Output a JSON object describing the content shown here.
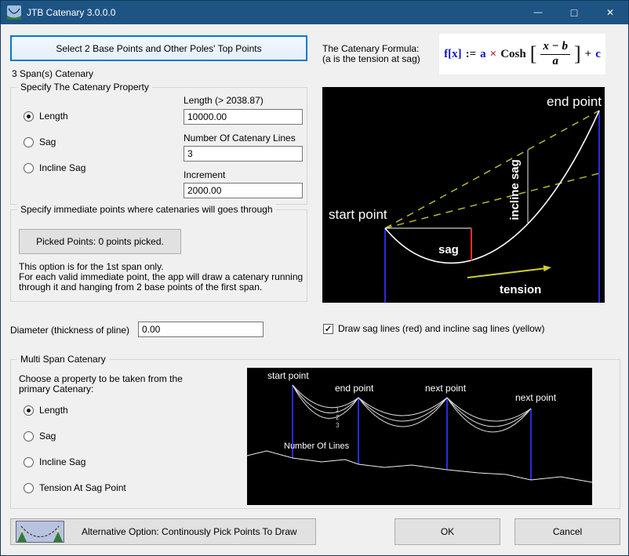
{
  "window": {
    "title": "JTB Catenary 3.0.0.0",
    "buttons": {
      "minimize": "—",
      "maximize": "□",
      "close": "✕"
    }
  },
  "top": {
    "select_button": "Select 2 Base Points and Other Poles' Top Points",
    "span_label": "3 Span(s) Catenary",
    "formula_caption_line1": "The Catenary Formula:",
    "formula_caption_line2": "(a is the tension at sag)",
    "formula": {
      "lhs": "f[x]",
      "assign": ":=",
      "a": "a",
      "times": "×",
      "func": "Cosh",
      "bracket_open": "[",
      "numerator": "x − b",
      "denominator": "a",
      "bracket_close": "]",
      "plus": "+",
      "c": "c"
    }
  },
  "property_group": {
    "title": "Specify The Catenary Property",
    "radios": [
      {
        "label": "Length",
        "selected": true
      },
      {
        "label": "Sag",
        "selected": false
      },
      {
        "label": "Incline Sag",
        "selected": false
      }
    ],
    "fields": [
      {
        "label": "Length (> 2038.87)",
        "value": "10000.00"
      },
      {
        "label": "Number Of Catenary Lines",
        "value": "3"
      },
      {
        "label": "Increment",
        "value": "2000.00"
      }
    ]
  },
  "immediate_group": {
    "title": "Specify immediate points where catenaries will goes through",
    "picked_button": "Picked Points: 0 points picked.",
    "notes": [
      "This option is for the 1st span only.",
      "For each valid immediate point, the app will draw a catenary running",
      "through it and  hanging from 2 base points of the first span."
    ]
  },
  "diameter": {
    "label": "Diameter (thickness of pline)",
    "value": "0.00"
  },
  "sag_checkbox": {
    "label": "Draw sag lines (red) and incline sag lines (yellow)",
    "checked": true,
    "check_glyph": "✓"
  },
  "diagram1": {
    "end_point": "end point",
    "start_point": "start point",
    "sag": "sag",
    "incline_sag": "incline sag",
    "tension": "tension"
  },
  "multi_group": {
    "title": "Multi Span Catenary",
    "caption_line1": "Choose a property to be taken from the",
    "caption_line2": "primary Catenary:",
    "radios": [
      {
        "label": "Length",
        "selected": true
      },
      {
        "label": "Sag",
        "selected": false
      },
      {
        "label": "Incline Sag",
        "selected": false
      },
      {
        "label": "Tension At Sag Point",
        "selected": false
      }
    ],
    "diagram": {
      "start_point": "start point",
      "end_point": "end point",
      "next_point1": "next point",
      "next_point2": "next point",
      "lines_label": "Number Of Lines",
      "numbers": [
        "1",
        "2",
        "3"
      ]
    }
  },
  "footer": {
    "alt_button": "Alternative Option: Continously Pick Points To Draw",
    "ok": "OK",
    "cancel": "Cancel"
  }
}
